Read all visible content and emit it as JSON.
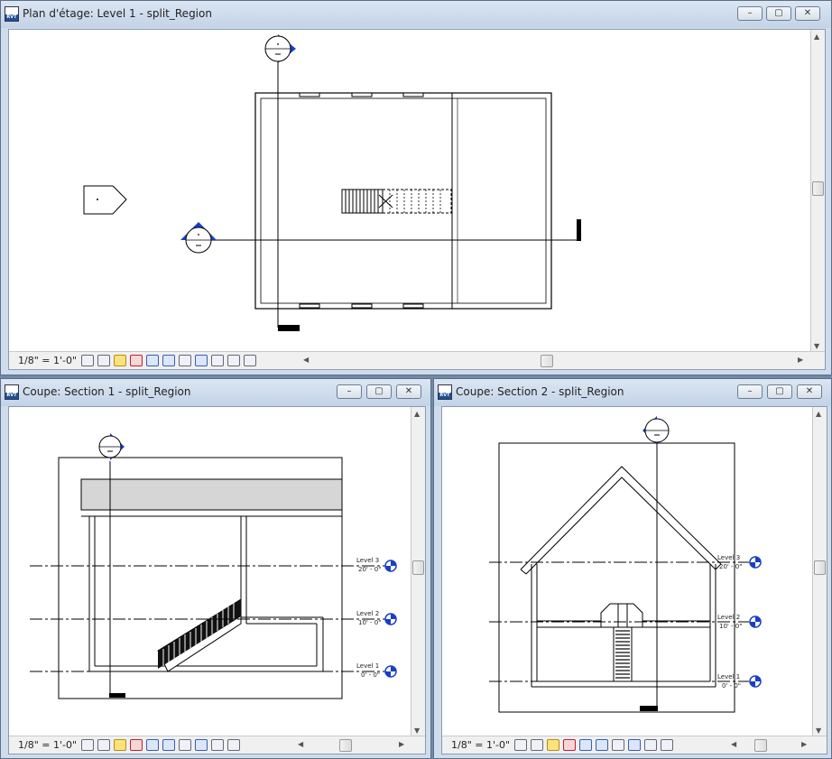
{
  "windows": {
    "plan": {
      "title": "Plan d'étage: Level 1 - split_Region",
      "scale": "1/8\" = 1'-0\""
    },
    "section1": {
      "title": "Coupe: Section 1 - split_Region",
      "scale": "1/8\" = 1'-0\""
    },
    "section2": {
      "title": "Coupe: Section 2 - split_Region",
      "scale": "1/8\" = 1'-0\""
    }
  },
  "window_buttons": {
    "minimize": "–",
    "maximize": "▢",
    "close": "✕"
  },
  "levels": {
    "level3": {
      "name": "Level 3",
      "elev": "20' - 0\""
    },
    "level2": {
      "name": "Level 2",
      "elev": "10' - 0\""
    },
    "level1": {
      "name": "Level 1",
      "elev": "0' - 0\""
    }
  },
  "view_tools": [
    "detail-level-icon",
    "visual-style-icon",
    "sun-path-icon",
    "shadows-icon",
    "crop-view-icon",
    "show-crop-icon",
    "temporary-hide-icon",
    "reveal-hidden-icon",
    "analytical-icon",
    "lock-view-icon",
    "worksharing-icon",
    "constraints-icon"
  ],
  "colors": {
    "accent": "#1a3ec8",
    "bg": "#6f8aa8"
  }
}
